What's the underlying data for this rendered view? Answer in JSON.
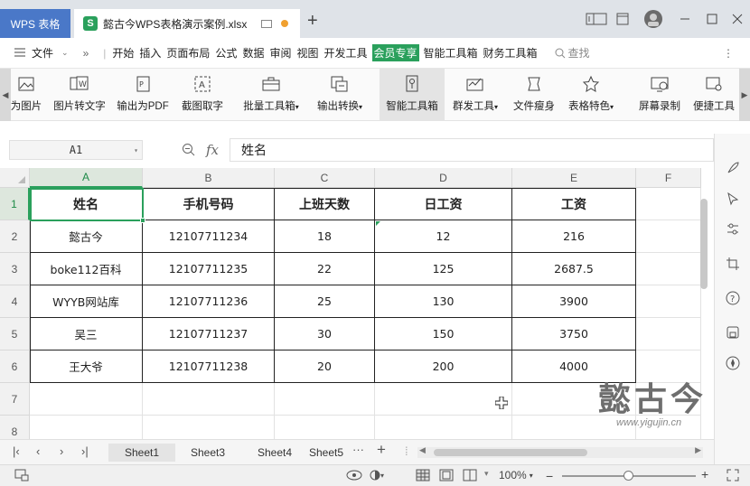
{
  "app": {
    "home_tab": "WPS 表格",
    "doc_tab": "懿古今WPS表格演示案例.xlsx",
    "doc_tab_icon": "S"
  },
  "menu": {
    "file_label": "文件",
    "items": [
      "开始",
      "插入",
      "页面布局",
      "公式",
      "数据",
      "审阅",
      "视图",
      "开发工具",
      "会员专享",
      "智能工具箱",
      "财务工具箱"
    ],
    "active": "会员专享",
    "search_label": "查找"
  },
  "toolbar": {
    "items": [
      {
        "label": "为图片",
        "icon": "image-icon"
      },
      {
        "label": "图片转文字",
        "icon": "image-to-text-icon"
      },
      {
        "label": "输出为PDF",
        "icon": "pdf-icon"
      },
      {
        "label": "截图取字",
        "icon": "screenshot-text-icon"
      },
      {
        "label": "批量工具箱",
        "icon": "toolbox-icon",
        "dropdown": true
      },
      {
        "label": "输出转换",
        "icon": "convert-icon",
        "dropdown": true
      },
      {
        "label": "智能工具箱",
        "icon": "smart-toolbox-icon"
      },
      {
        "label": "群发工具",
        "icon": "mass-send-icon",
        "dropdown": true
      },
      {
        "label": "文件瘦身",
        "icon": "file-slim-icon"
      },
      {
        "label": "表格特色",
        "icon": "table-feature-icon",
        "dropdown": true
      },
      {
        "label": "屏幕录制",
        "icon": "screen-record-icon"
      },
      {
        "label": "便捷工具",
        "icon": "handy-tools-icon"
      }
    ],
    "selected": "智能工具箱"
  },
  "formula": {
    "cell_ref": "A1",
    "fx_label": "fx",
    "content": "姓名"
  },
  "sheet": {
    "columns": [
      "A",
      "B",
      "C",
      "D",
      "E",
      "F"
    ],
    "selected_col": "A",
    "rows": [
      "1",
      "2",
      "3",
      "4",
      "5",
      "6",
      "7",
      "8"
    ],
    "selected_row": "1",
    "header": [
      "姓名",
      "手机号码",
      "上班天数",
      "日工资",
      "工资"
    ],
    "data": [
      [
        "懿古今",
        "12107711234",
        "18",
        "12",
        "216"
      ],
      [
        "boke112百科",
        "12107711235",
        "22",
        "125",
        "2687.5"
      ],
      [
        "WYYB网站库",
        "12107711236",
        "25",
        "130",
        "3900"
      ],
      [
        "吴三",
        "12107711237",
        "30",
        "150",
        "3750"
      ],
      [
        "王大爷",
        "12107711238",
        "20",
        "200",
        "4000"
      ]
    ]
  },
  "watermark": {
    "title": "懿古今",
    "url": "www.yigujin.cn"
  },
  "tabs": {
    "sheets": [
      "Sheet1",
      "Sheet3",
      "Sheet4",
      "Sheet5"
    ],
    "active": "Sheet1",
    "more": "···",
    "add": "+"
  },
  "status": {
    "zoom": "100%",
    "zoom_minus": "−",
    "zoom_plus": "+"
  },
  "colors": {
    "accent": "#2aa05c",
    "wps_tab": "#4a78c8"
  }
}
